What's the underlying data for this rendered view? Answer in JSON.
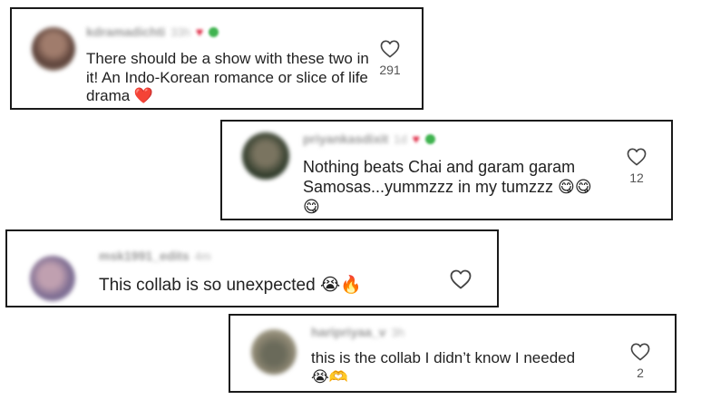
{
  "comments": [
    {
      "username": "kdramadichti",
      "time": "33h",
      "text": "There should be a show with these two in it! An Indo-Korean romance or slice of life drama ❤️",
      "likes": "291",
      "avatar_colors": [
        "#5a4038",
        "#a07c6c"
      ]
    },
    {
      "username": "priyankasdixit",
      "time": "1d",
      "text": "Nothing beats Chai and garam garam Samosas...yummzzz in my tumzzz 😋😋😋",
      "likes": "12",
      "avatar_colors": [
        "#2e3a2a",
        "#7a7460"
      ]
    },
    {
      "username": "msk1991_edits",
      "time": "4m",
      "text": "This collab is so unexpected 😭🔥",
      "likes": "",
      "avatar_colors": [
        "#c0a0b0",
        "#7a6a90"
      ]
    },
    {
      "username": "haripriyaa_v",
      "time": "3h",
      "text": "this is the collab I didn’t know I needed😭🫶",
      "likes": "2",
      "avatar_colors": [
        "#6a6a5a",
        "#c8c4b0"
      ]
    }
  ],
  "colors": {
    "border": "#1a1a1a",
    "text": "#222222",
    "username": "#9a9a9a",
    "heart_badge": "#e0304a",
    "green_badge": "#3fb34f"
  },
  "icons": {
    "like": "heart-outline-icon"
  }
}
